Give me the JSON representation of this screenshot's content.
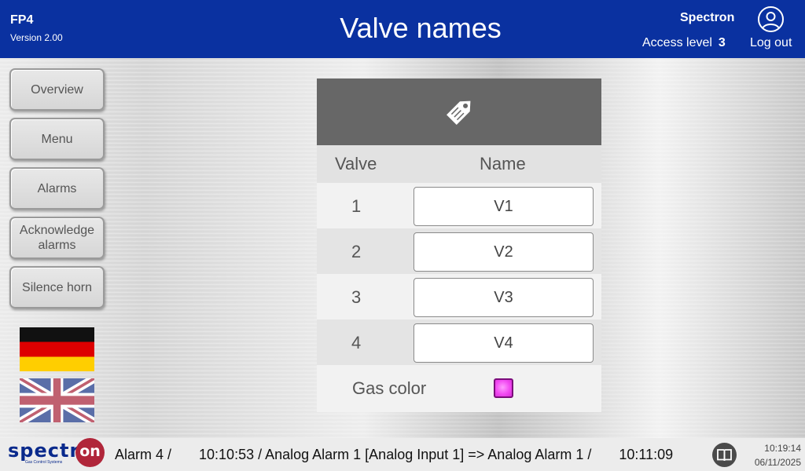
{
  "header": {
    "app_name": "FP4",
    "version": "Version 2.00",
    "title": "Valve names",
    "company": "Spectron",
    "access_label": "Access level",
    "access_value": "3",
    "logout_label": "Log out"
  },
  "sidebar": {
    "items": [
      {
        "label": "Overview"
      },
      {
        "label": "Menu"
      },
      {
        "label": "Alarms"
      },
      {
        "label": "Acknowledge alarms"
      },
      {
        "label": "Silence horn"
      }
    ],
    "languages": [
      "german-flag-icon",
      "uk-flag-icon"
    ]
  },
  "panel": {
    "icon": "tag-icon",
    "col_valve": "Valve",
    "col_name": "Name",
    "rows": [
      {
        "num": "1",
        "name": "V1"
      },
      {
        "num": "2",
        "name": "V2"
      },
      {
        "num": "3",
        "name": "V3"
      },
      {
        "num": "4",
        "name": "V4"
      }
    ],
    "gas_label": "Gas color",
    "gas_color": "#f24af2"
  },
  "footer": {
    "logo_text": "spectr",
    "logo_badge": "on",
    "logo_sub": "Gas Control Systems",
    "ticker": "Alarm 4 /       10:10:53 / Analog Alarm 1 [Analog Input 1] => Analog Alarm 1 /       10:11:09",
    "time": "10:19:14",
    "date": "06/11/2025"
  },
  "colors": {
    "header_bg": "#0a31a0",
    "panel_head": "#676767",
    "logo_red": "#b0263a"
  }
}
